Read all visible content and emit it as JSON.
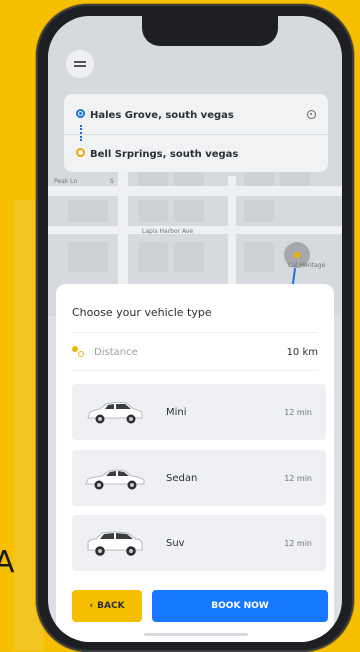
{
  "background": {
    "glyph": "A"
  },
  "colors": {
    "accent": "#f6c000",
    "primary": "#1677ff",
    "pickup": "#1f6fe0",
    "dropoff": "#f0a800"
  },
  "map": {
    "labels": [
      "Peak Ln",
      "S",
      "Lapis Harbor Ave",
      "Cal Heritage"
    ]
  },
  "route": {
    "pickup": "Hales Grove, south vegas",
    "dropoff": "Bell Srprings, south vegas"
  },
  "sheet": {
    "title": "Choose your vehicle type",
    "distance_label": "Distance",
    "distance_value": "10 km",
    "vehicles": [
      {
        "name": "Mini",
        "time": "12 min",
        "icon": "car-hatchback-icon"
      },
      {
        "name": "Sedan",
        "time": "12 min",
        "icon": "car-sedan-icon"
      },
      {
        "name": "Suv",
        "time": "12 min",
        "icon": "car-suv-icon"
      }
    ],
    "back_label": "BACK",
    "book_label": "BOOK NOW"
  },
  "icons": [
    "menu-icon",
    "pickup-pin-icon",
    "dropoff-pin-icon",
    "locate-icon",
    "location-marker-icon",
    "distance-icon",
    "chevron-left-icon"
  ]
}
